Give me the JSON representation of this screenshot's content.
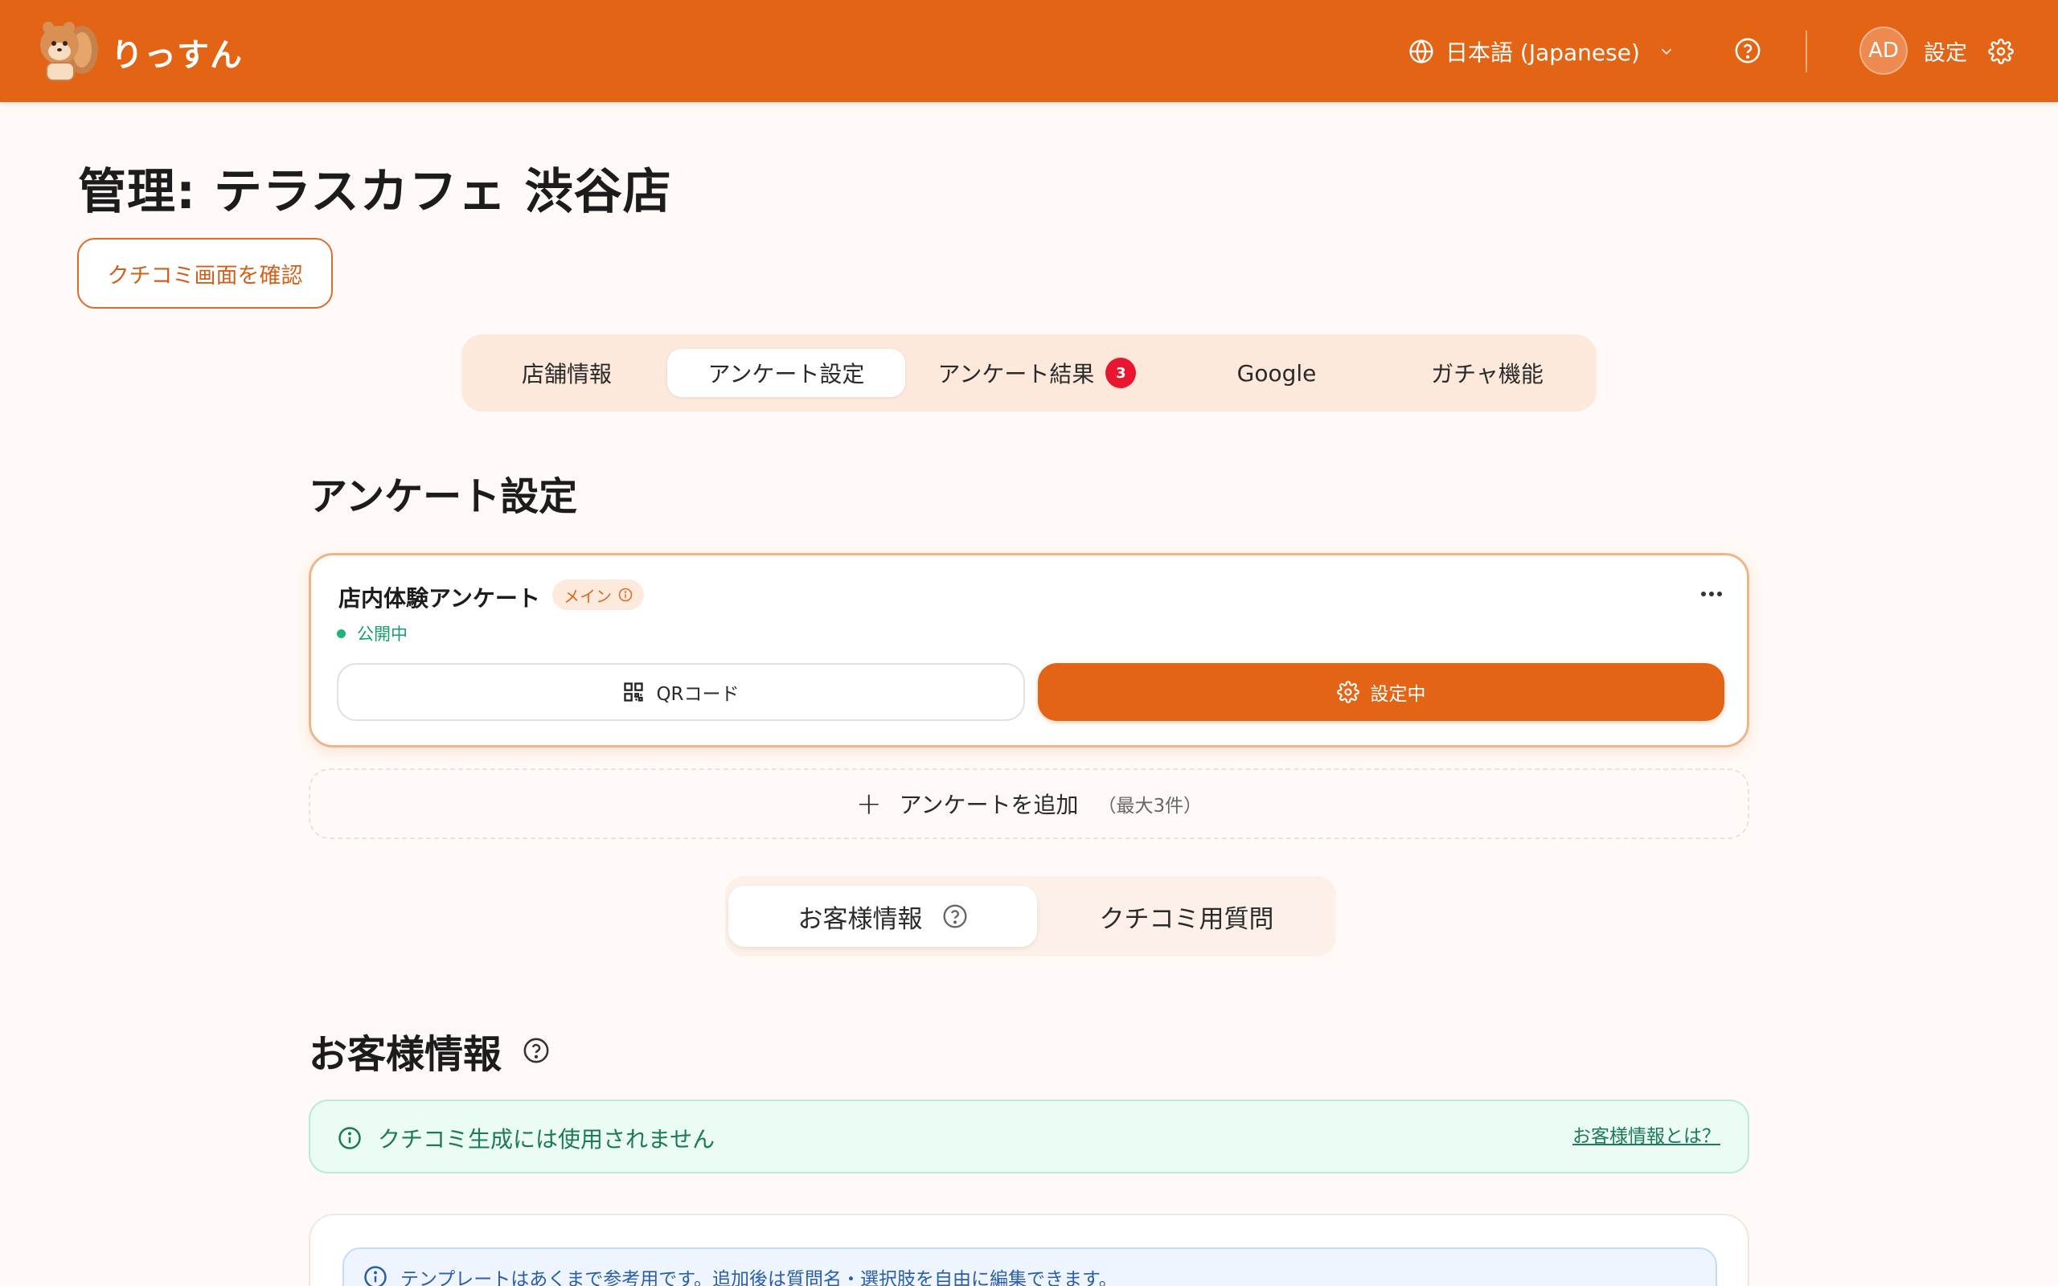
{
  "header": {
    "brand": "りっすん",
    "language": "日本語 (Japanese)",
    "avatar_initials": "AD",
    "settings_label": "設定",
    "accent_color": "#e36414"
  },
  "page": {
    "title": "管理: テラスカフェ 渋谷店",
    "review_button": "クチコミ画面を確認"
  },
  "main_tabs": [
    {
      "label": "店舗情報",
      "active": false
    },
    {
      "label": "アンケート設定",
      "active": true
    },
    {
      "label": "アンケート結果",
      "active": false,
      "badge": "3"
    },
    {
      "label": "Google",
      "active": false
    },
    {
      "label": "ガチャ機能",
      "active": false
    }
  ],
  "survey_section": {
    "title": "アンケート設定",
    "card": {
      "name": "店内体験アンケート",
      "tag": "メイン",
      "status": "公開中",
      "qr_button": "QRコード",
      "setting_button": "設定中"
    },
    "add_button": "アンケートを追加",
    "add_limit": "（最大3件）"
  },
  "sub_tabs": [
    {
      "label": "お客様情報",
      "active": true
    },
    {
      "label": "クチコミ用質問",
      "active": false
    }
  ],
  "customer_info": {
    "title": "お客様情報",
    "notice": "クチコミ生成には使用されません",
    "notice_link": "お客様情報とは？",
    "template_note": "テンプレートはあくまで参考用です。追加後は質問名・選択肢を自由に編集できます。"
  }
}
